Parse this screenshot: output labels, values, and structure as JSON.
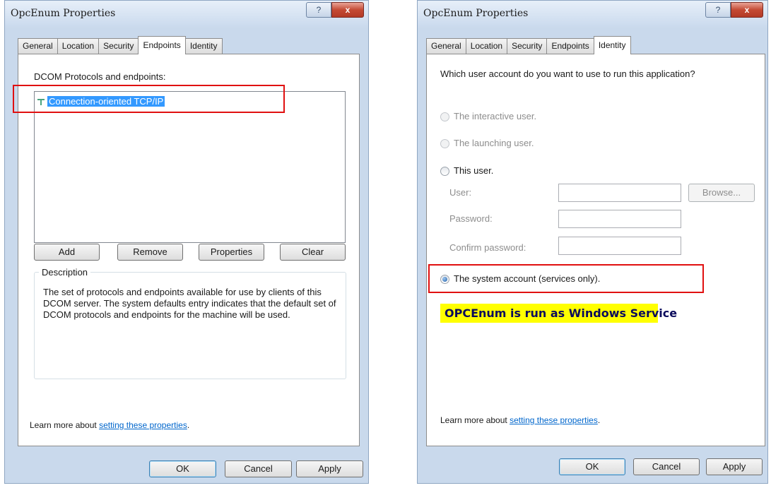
{
  "left_dialog": {
    "title": "OpcEnum Properties",
    "help_glyph": "?",
    "close_glyph": "x",
    "tabs": [
      {
        "label": "General"
      },
      {
        "label": "Location"
      },
      {
        "label": "Security"
      },
      {
        "label": "Endpoints"
      },
      {
        "label": "Identity"
      }
    ],
    "active_tab": "Endpoints",
    "list_caption": "DCOM Protocols and endpoints:",
    "list_items": [
      {
        "label": "Connection-oriented TCP/IP",
        "icon": "network-protocol-icon",
        "selected": true
      }
    ],
    "buttons": {
      "add": "Add",
      "remove": "Remove",
      "properties": "Properties",
      "clear": "Clear"
    },
    "description_legend": "Description",
    "description_text": "The set of protocols and endpoints available for use by clients of this DCOM server. The system defaults entry indicates that the default set of DCOM protocols and endpoints for the machine will be used.",
    "learn_more_prefix": "Learn more about",
    "learn_more_link": "setting these properties",
    "learn_more_suffix": ".",
    "footer": {
      "ok": "OK",
      "cancel": "Cancel",
      "apply": "Apply"
    },
    "highlight_color": "#e01010"
  },
  "right_dialog": {
    "title": "OpcEnum Properties",
    "help_glyph": "?",
    "close_glyph": "x",
    "tabs": [
      {
        "label": "General"
      },
      {
        "label": "Location"
      },
      {
        "label": "Security"
      },
      {
        "label": "Endpoints"
      },
      {
        "label": "Identity"
      }
    ],
    "active_tab": "Identity",
    "question": "Which user account do you want to use to run this application?",
    "options": {
      "interactive": "The interactive user.",
      "launching": "The launching user.",
      "this_user": "This user.",
      "system": "The system account (services only)."
    },
    "selected_option": "system",
    "fields": {
      "user_label": "User:",
      "password_label": "Password:",
      "confirm_label": "Confirm password:",
      "user_value": "",
      "password_value": "",
      "confirm_value": ""
    },
    "browse_button": "Browse...",
    "annotation": "OPCEnum is run as  Windows Service",
    "learn_more_prefix": "Learn more about",
    "learn_more_link": "setting these properties",
    "learn_more_suffix": ".",
    "footer": {
      "ok": "OK",
      "cancel": "Cancel",
      "apply": "Apply"
    },
    "highlight_color": "#ffff00"
  }
}
